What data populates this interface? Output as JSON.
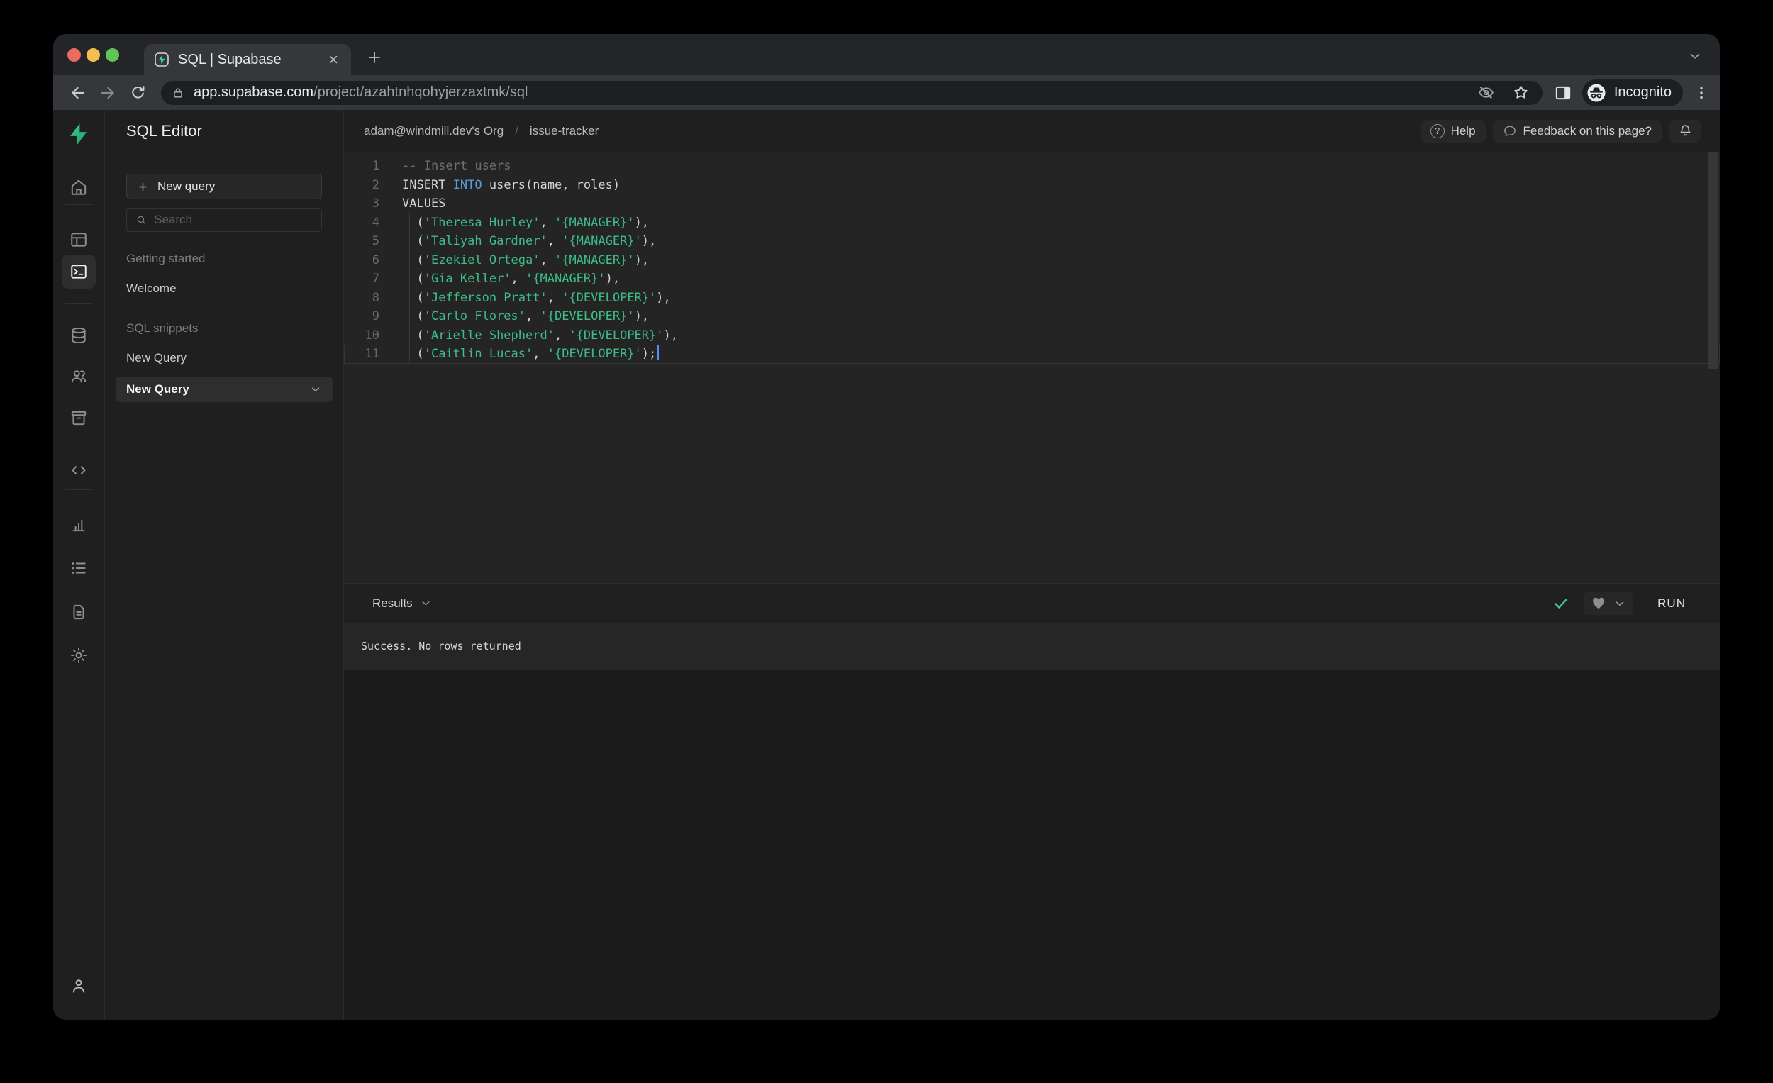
{
  "browser": {
    "tab_title": "SQL | Supabase",
    "url_host": "app.supabase.com",
    "url_path": "/project/azahtnhqohyjerzaxtmk/sql",
    "incognito_label": "Incognito"
  },
  "app_header": {
    "title": "SQL Editor",
    "breadcrumb_org": "adam@windmill.dev's Org",
    "breadcrumb_separator": "/",
    "breadcrumb_project": "issue-tracker",
    "help_label": "Help",
    "help_icon_glyph": "?",
    "feedback_label": "Feedback on this page?"
  },
  "sidebar": {
    "new_query_label": "New query",
    "search_placeholder": "Search",
    "sections": [
      {
        "label": "Getting started",
        "items": [
          {
            "label": "Welcome"
          }
        ]
      },
      {
        "label": "SQL snippets",
        "items": [
          {
            "label": "New Query"
          }
        ]
      }
    ],
    "selected_item_label": "New Query"
  },
  "editor": {
    "cursor_line": "11",
    "lines": [
      {
        "num": "1",
        "tokens": [
          {
            "c": "comment",
            "t": "-- Insert users"
          }
        ]
      },
      {
        "num": "2",
        "tokens": [
          {
            "c": "plain",
            "t": "INSERT "
          },
          {
            "c": "keyword",
            "t": "INTO"
          },
          {
            "c": "plain",
            "t": " users(name, roles)"
          }
        ]
      },
      {
        "num": "3",
        "tokens": [
          {
            "c": "plain",
            "t": "VALUES"
          }
        ]
      },
      {
        "num": "4",
        "tokens": [
          {
            "c": "plain",
            "t": "  ("
          },
          {
            "c": "string",
            "t": "'Theresa Hurley'"
          },
          {
            "c": "plain",
            "t": ", "
          },
          {
            "c": "string",
            "t": "'{MANAGER}'"
          },
          {
            "c": "plain",
            "t": "),"
          }
        ]
      },
      {
        "num": "5",
        "tokens": [
          {
            "c": "plain",
            "t": "  ("
          },
          {
            "c": "string",
            "t": "'Taliyah Gardner'"
          },
          {
            "c": "plain",
            "t": ", "
          },
          {
            "c": "string",
            "t": "'{MANAGER}'"
          },
          {
            "c": "plain",
            "t": "),"
          }
        ]
      },
      {
        "num": "6",
        "tokens": [
          {
            "c": "plain",
            "t": "  ("
          },
          {
            "c": "string",
            "t": "'Ezekiel Ortega'"
          },
          {
            "c": "plain",
            "t": ", "
          },
          {
            "c": "string",
            "t": "'{MANAGER}'"
          },
          {
            "c": "plain",
            "t": "),"
          }
        ]
      },
      {
        "num": "7",
        "tokens": [
          {
            "c": "plain",
            "t": "  ("
          },
          {
            "c": "string",
            "t": "'Gia Keller'"
          },
          {
            "c": "plain",
            "t": ", "
          },
          {
            "c": "string",
            "t": "'{MANAGER}'"
          },
          {
            "c": "plain",
            "t": "),"
          }
        ]
      },
      {
        "num": "8",
        "tokens": [
          {
            "c": "plain",
            "t": "  ("
          },
          {
            "c": "string",
            "t": "'Jefferson Pratt'"
          },
          {
            "c": "plain",
            "t": ", "
          },
          {
            "c": "string",
            "t": "'{DEVELOPER}'"
          },
          {
            "c": "plain",
            "t": "),"
          }
        ]
      },
      {
        "num": "9",
        "tokens": [
          {
            "c": "plain",
            "t": "  ("
          },
          {
            "c": "string",
            "t": "'Carlo Flores'"
          },
          {
            "c": "plain",
            "t": ", "
          },
          {
            "c": "string",
            "t": "'{DEVELOPER}'"
          },
          {
            "c": "plain",
            "t": "),"
          }
        ]
      },
      {
        "num": "10",
        "tokens": [
          {
            "c": "plain",
            "t": "  ("
          },
          {
            "c": "string",
            "t": "'Arielle Shepherd'"
          },
          {
            "c": "plain",
            "t": ", "
          },
          {
            "c": "string",
            "t": "'{DEVELOPER}'"
          },
          {
            "c": "plain",
            "t": "),"
          }
        ]
      },
      {
        "num": "11",
        "tokens": [
          {
            "c": "plain",
            "t": "  ("
          },
          {
            "c": "string",
            "t": "'Caitlin Lucas'"
          },
          {
            "c": "plain",
            "t": ", "
          },
          {
            "c": "string",
            "t": "'{DEVELOPER}'"
          },
          {
            "c": "plain",
            "t": ");"
          }
        ]
      }
    ]
  },
  "results": {
    "label": "Results",
    "message": "Success. No rows returned",
    "run_label": "RUN"
  },
  "colors": {
    "accent_green": "#3ecf8e",
    "keyword_blue": "#569cd6",
    "string_green": "#3dbd87",
    "cursor_blue": "#4f8ff7"
  }
}
